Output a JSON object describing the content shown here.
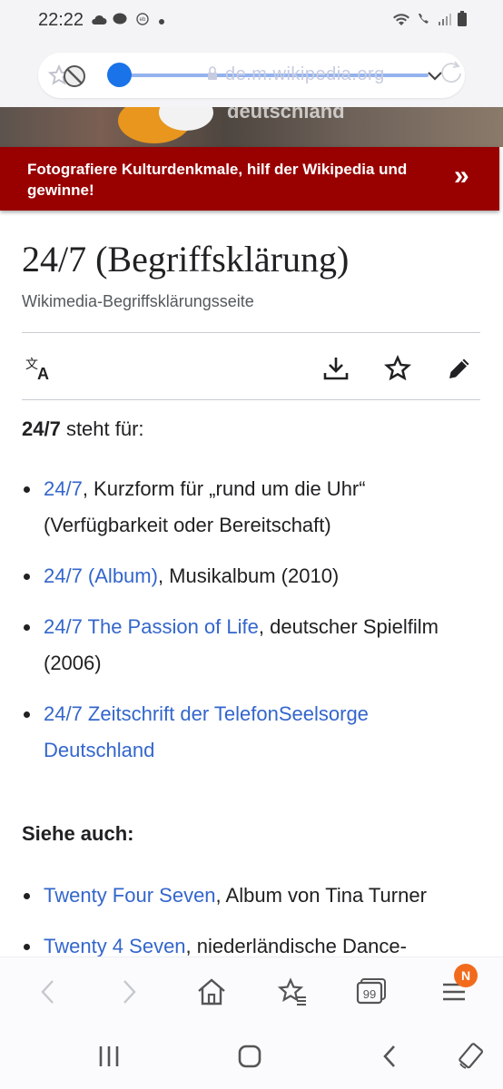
{
  "status_bar": {
    "time": "22:22",
    "icons": [
      "cloud-icon",
      "message-icon",
      "ebay-icon",
      "dot-icon",
      "wifi-icon",
      "wifi-call-icon",
      "signal-icon",
      "battery-icon"
    ]
  },
  "browser": {
    "url": "de.m.wikipedia.org"
  },
  "campaign_banner": {
    "text": "Fotografiere Kulturdenkmale, hilf der Wikipedia und gewinne!",
    "arrow": "»",
    "image_text": "deutschland",
    "accent_color": "#990000"
  },
  "article": {
    "title": "24/7 (Begriffsklärung)",
    "description": "Wikimedia-Begriffsklärungsseite",
    "lead_bold": "24/7",
    "lead_rest": " steht für:",
    "items": [
      {
        "link": "24/7",
        "text": ", Kurzform für „rund um die Uhr“ (Verfügbarkeit oder Bereitschaft)"
      },
      {
        "link": "24/7 (Album)",
        "text": ", Musikalbum (2010)"
      },
      {
        "link": "24/7 The Passion of Life",
        "text": ", deutscher Spielfilm (2006)"
      },
      {
        "link": "24/7 Zeitschrift der TelefonSeelsorge Deutschland",
        "text": ""
      }
    ],
    "see_also_heading": "Siehe auch:",
    "see_also": [
      {
        "link": "Twenty Four Seven",
        "text": ", Album von Tina Turner"
      },
      {
        "link": "Twenty 4 Seven",
        "text": ", niederländische Dance-"
      }
    ]
  },
  "toolbar": {
    "tabs_count": "99",
    "menu_badge": "N"
  },
  "colors": {
    "link": "#3366cc",
    "text": "#202122",
    "muted": "#54595d",
    "slider": "#1a73e8",
    "badge": "#f26b1d"
  }
}
